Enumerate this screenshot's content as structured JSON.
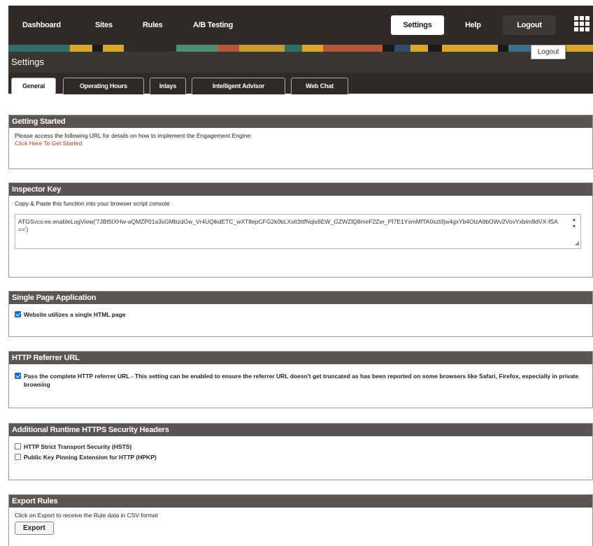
{
  "nav": {
    "items": [
      "Dashboard",
      "Sites",
      "Rules",
      "A/B Testing"
    ],
    "settings_label": "Settings",
    "help_label": "Help",
    "logout_label": "Logout",
    "apps_icon": "grid-icon"
  },
  "tooltip": "Logout",
  "page_title": "Settings",
  "tabs": [
    "General",
    "Operating Hours",
    "Inlays",
    "Intelligent Advisor",
    "Web Chat"
  ],
  "active_tab": "General",
  "getting_started": {
    "header": "Getting Started",
    "text": "Please access the following URL for details on how to implement the Engagement Engine:",
    "link": "Click Here To Get Started"
  },
  "inspector_key": {
    "header": "Inspector Key",
    "text": "Copy & Paste this function into your browser script console",
    "value": "ATGSvcs.ee.enableLogView('7JBt5tXHw-aQMZP01a3sGMbzdGw_Vr4UQlkdETC_wXT8epCFG2k0bLXsIt3ttfNqls6EW_GZWZlQ8meF2Zer_PI7E1YxmMfTA0xztifjw4gxYb4OlzA9bOWv2VovYxblm8dVX-fSA==')"
  },
  "spa": {
    "header": "Single Page Application",
    "checkbox_label": "Website utilizes a single HTML page",
    "checked": true
  },
  "referrer": {
    "header": "HTTP Referrer URL",
    "checkbox_label": "Pass the complete HTTP referrer URL - This setting can be enabled to ensure the referrer URL doesn't get truncated as has been reported on some browsers like Safari, Firefox, especially in private browsing",
    "checked": true
  },
  "security_headers": {
    "header": "Additional Runtime HTTPS Security Headers",
    "options": [
      {
        "label": "HTTP Strict Transport Security (HSTS)",
        "checked": false
      },
      {
        "label": "Public Key Pinning Extension for HTTP (HPKP)",
        "checked": false
      }
    ]
  },
  "export_rules": {
    "header": "Export Rules",
    "text": "Click on Export to receive the Rule data in CSV format",
    "button": "Export"
  },
  "colors": {
    "nav_bg": "#2f2a26",
    "panel_header": "#5a5550",
    "link": "#b23b1e",
    "checkbox_checked": "#1a6fc9"
  }
}
